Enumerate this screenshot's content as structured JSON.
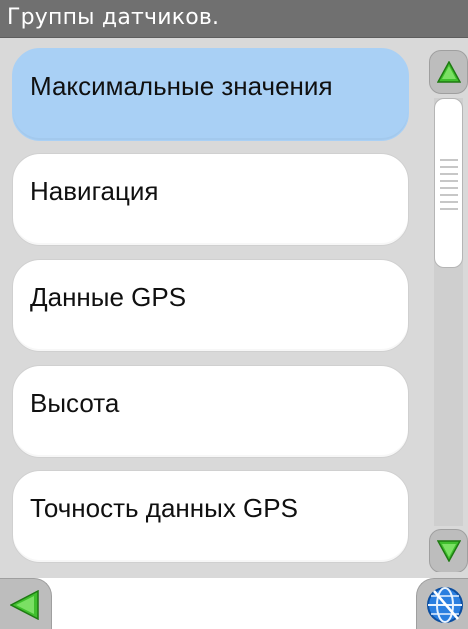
{
  "header": {
    "title": "Группы датчиков."
  },
  "list": {
    "items": [
      {
        "label": "Максимальные значения",
        "selected": true
      },
      {
        "label": "Навигация",
        "selected": false
      },
      {
        "label": "Данные GPS",
        "selected": false
      },
      {
        "label": "Высота",
        "selected": false
      },
      {
        "label": "Точность данных GPS",
        "selected": false
      }
    ]
  },
  "icons": {
    "scroll_up": "triangle-up-icon",
    "scroll_down": "triangle-down-icon",
    "back": "triangle-left-icon",
    "globe": "globe-icon"
  },
  "colors": {
    "title_bar": "#707070",
    "selected_item": "#a9d0f5",
    "arrow_green": "#3fbf2d",
    "globe_blue": "#2a7fe0"
  }
}
